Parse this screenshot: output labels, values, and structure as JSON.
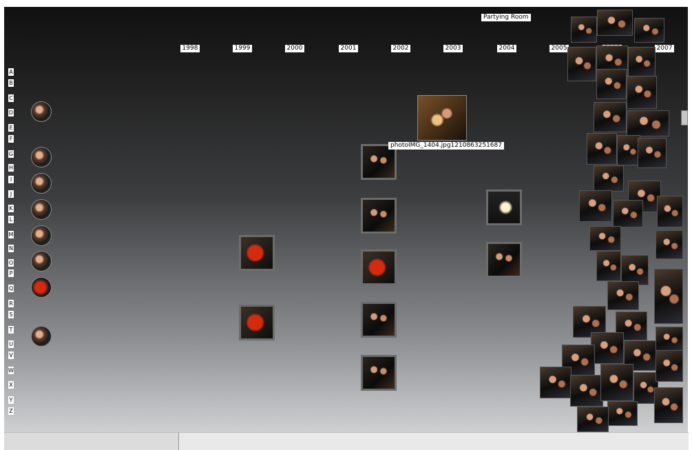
{
  "timeline": {
    "years": [
      "1998",
      "1999",
      "2000",
      "2001",
      "2002",
      "2003",
      "2004",
      "2005",
      "2006",
      "2007"
    ]
  },
  "index": {
    "letters": [
      "A",
      "B",
      "C",
      "D",
      "E",
      "F",
      "G",
      "H",
      "I",
      "J",
      "K",
      "L",
      "M",
      "N",
      "O",
      "P",
      "Q",
      "R",
      "S",
      "T",
      "U",
      "V",
      "W",
      "X",
      "Y",
      "Z"
    ]
  },
  "labels": {
    "event_label": "Partying Room",
    "photo_tooltip": "photoIMG_1404.jpg1210863251687"
  },
  "colors": {
    "accent_red": "#d42a10"
  }
}
